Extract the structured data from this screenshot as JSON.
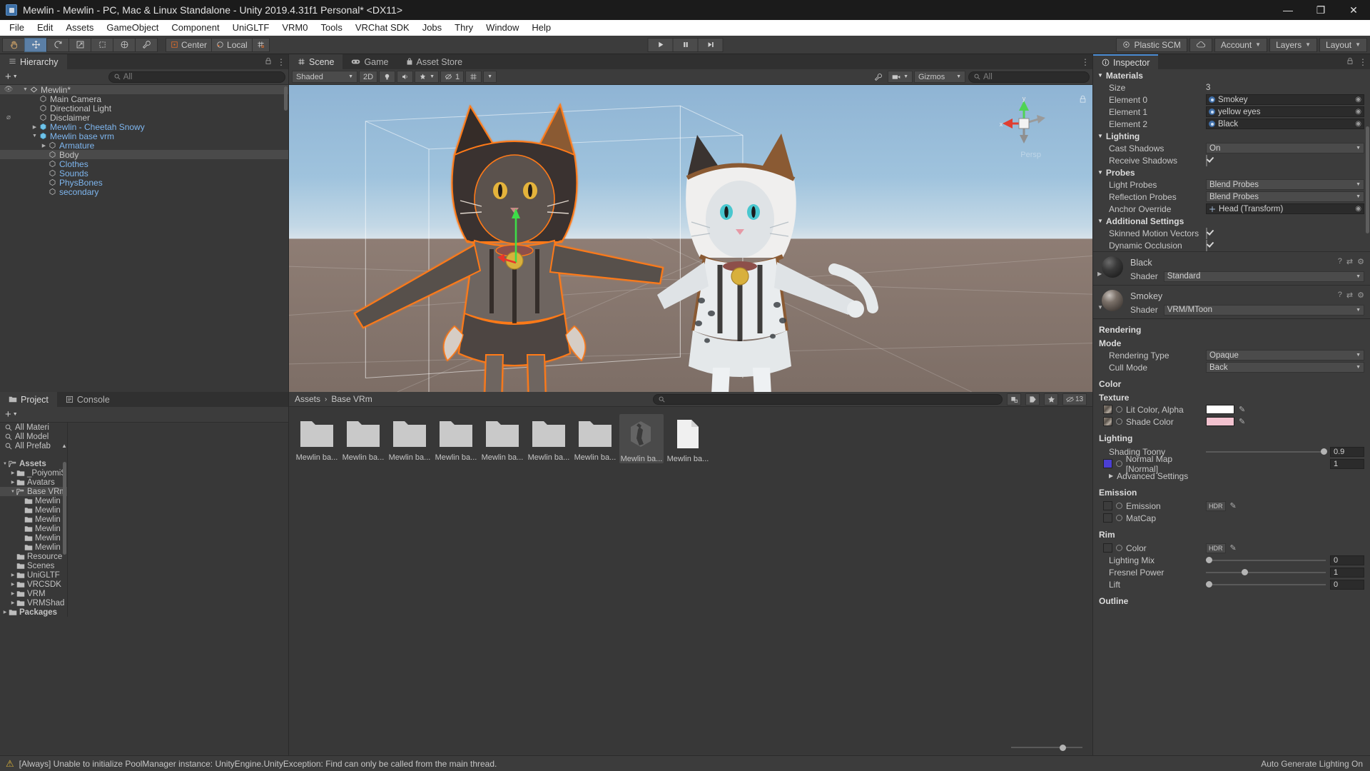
{
  "window": {
    "title": "Mewlin - Mewlin - PC, Mac & Linux Standalone - Unity 2019.4.31f1 Personal* <DX11>",
    "minimize": "—",
    "maximize": "❐",
    "close": "✕"
  },
  "menu": [
    "File",
    "Edit",
    "Assets",
    "GameObject",
    "Component",
    "UniGLTF",
    "VRM0",
    "Tools",
    "VRChat SDK",
    "Jobs",
    "Thry",
    "Window",
    "Help"
  ],
  "toolbar": {
    "pivot_mode": "Center",
    "pivot_rotation": "Local",
    "plastic_scm": "Plastic SCM",
    "account": "Account",
    "layers": "Layers",
    "layout": "Layout"
  },
  "hierarchy": {
    "tab": "Hierarchy",
    "search_placeholder": "All",
    "items": [
      {
        "label": "Mewlin*",
        "depth": 0,
        "icon": "scene-icon",
        "twisty": "down",
        "prefab": false,
        "selected": true,
        "eye": true
      },
      {
        "label": "Main Camera",
        "depth": 1,
        "icon": "gameobject-icon",
        "twisty": "",
        "prefab": false,
        "selected": false
      },
      {
        "label": "Directional Light",
        "depth": 1,
        "icon": "gameobject-icon",
        "twisty": "",
        "prefab": false,
        "selected": false
      },
      {
        "label": "Disclaimer",
        "depth": 1,
        "icon": "gameobject-icon",
        "twisty": "",
        "prefab": false,
        "selected": false,
        "hidden": true
      },
      {
        "label": "Mewlin - Cheetah Snowy",
        "depth": 1,
        "icon": "prefab-icon",
        "twisty": "right",
        "prefab": true,
        "selected": false
      },
      {
        "label": "Mewlin base vrm",
        "depth": 1,
        "icon": "prefab-icon",
        "twisty": "down",
        "prefab": true,
        "selected": false
      },
      {
        "label": "Armature",
        "depth": 2,
        "icon": "gameobject-icon",
        "twisty": "right",
        "prefab": true,
        "selected": false
      },
      {
        "label": "Body",
        "depth": 2,
        "icon": "gameobject-icon",
        "twisty": "",
        "prefab": false,
        "selected": true
      },
      {
        "label": "Clothes",
        "depth": 2,
        "icon": "gameobject-icon",
        "twisty": "",
        "prefab": true,
        "selected": false
      },
      {
        "label": "Sounds",
        "depth": 2,
        "icon": "gameobject-icon",
        "twisty": "",
        "prefab": true,
        "selected": false
      },
      {
        "label": "PhysBones",
        "depth": 2,
        "icon": "gameobject-icon",
        "twisty": "",
        "prefab": true,
        "selected": false
      },
      {
        "label": "secondary",
        "depth": 2,
        "icon": "gameobject-icon",
        "twisty": "",
        "prefab": true,
        "selected": false
      }
    ]
  },
  "scene": {
    "tabs": [
      {
        "label": "Scene",
        "icon": "grid-icon",
        "active": true
      },
      {
        "label": "Game",
        "icon": "gamepad-icon",
        "active": false
      },
      {
        "label": "Asset Store",
        "icon": "store-icon",
        "active": false
      }
    ],
    "draw_mode": "Shaded",
    "two_d": "2D",
    "gizmos": "Gizmos",
    "search_placeholder": "All",
    "audio_count": "1",
    "gizmo_axes": {
      "x": "x",
      "y": "y"
    },
    "perspective_label": "Persp"
  },
  "project": {
    "tabs": [
      {
        "label": "Project",
        "icon": "folder-icon",
        "active": true
      },
      {
        "label": "Console",
        "icon": "console-icon",
        "active": false
      }
    ],
    "breadcrumb": [
      "Assets",
      "Base VRm"
    ],
    "search_placeholder": "",
    "favorites": [
      "All Materi",
      "All Model",
      "All Prefab"
    ],
    "tree": [
      {
        "label": "Assets",
        "depth": 0,
        "twisty": "down",
        "open": true,
        "selected": false
      },
      {
        "label": "_PoiyomiS",
        "depth": 1,
        "twisty": "right",
        "open": false,
        "selected": false
      },
      {
        "label": "Avatars",
        "depth": 1,
        "twisty": "right",
        "open": false,
        "selected": false
      },
      {
        "label": "Base VRm",
        "depth": 1,
        "twisty": "down",
        "open": true,
        "selected": true
      },
      {
        "label": "Mewlin",
        "depth": 2,
        "twisty": "",
        "open": false,
        "selected": false
      },
      {
        "label": "Mewlin",
        "depth": 2,
        "twisty": "",
        "open": false,
        "selected": false
      },
      {
        "label": "Mewlin",
        "depth": 2,
        "twisty": "",
        "open": false,
        "selected": false
      },
      {
        "label": "Mewlin",
        "depth": 2,
        "twisty": "",
        "open": false,
        "selected": false
      },
      {
        "label": "Mewlin",
        "depth": 2,
        "twisty": "",
        "open": false,
        "selected": false
      },
      {
        "label": "Mewlin",
        "depth": 2,
        "twisty": "",
        "open": false,
        "selected": false
      },
      {
        "label": "Resource",
        "depth": 1,
        "twisty": "",
        "open": false,
        "selected": false
      },
      {
        "label": "Scenes",
        "depth": 1,
        "twisty": "",
        "open": false,
        "selected": false
      },
      {
        "label": "UniGLTF",
        "depth": 1,
        "twisty": "right",
        "open": false,
        "selected": false
      },
      {
        "label": "VRCSDK",
        "depth": 1,
        "twisty": "right",
        "open": false,
        "selected": false
      },
      {
        "label": "VRM",
        "depth": 1,
        "twisty": "right",
        "open": false,
        "selected": false
      },
      {
        "label": "VRMShad",
        "depth": 1,
        "twisty": "right",
        "open": false,
        "selected": false
      },
      {
        "label": "Packages",
        "depth": 0,
        "twisty": "right",
        "open": false,
        "selected": false
      }
    ],
    "assets": [
      {
        "label": "Mewlin ba...",
        "type": "folder",
        "selected": false
      },
      {
        "label": "Mewlin ba...",
        "type": "folder",
        "selected": false
      },
      {
        "label": "Mewlin ba...",
        "type": "folder",
        "selected": false
      },
      {
        "label": "Mewlin ba...",
        "type": "folder",
        "selected": false
      },
      {
        "label": "Mewlin ba...",
        "type": "folder",
        "selected": false
      },
      {
        "label": "Mewlin ba...",
        "type": "folder",
        "selected": false
      },
      {
        "label": "Mewlin ba...",
        "type": "folder",
        "selected": false
      },
      {
        "label": "Mewlin ba...",
        "type": "model",
        "selected": true
      },
      {
        "label": "Mewlin ba...",
        "type": "file",
        "selected": false
      }
    ],
    "badge_count": "13"
  },
  "inspector": {
    "tab": "Inspector",
    "sections": {
      "materials": {
        "header": "Materials",
        "size_label": "Size",
        "size_value": "3",
        "elements": [
          {
            "label": "Element 0",
            "value": "Smokey"
          },
          {
            "label": "Element 1",
            "value": "yellow eyes"
          },
          {
            "label": "Element 2",
            "value": "Black"
          }
        ]
      },
      "lighting": {
        "header": "Lighting",
        "cast_shadows_label": "Cast Shadows",
        "cast_shadows_value": "On",
        "receive_shadows_label": "Receive Shadows",
        "receive_shadows_checked": true
      },
      "probes": {
        "header": "Probes",
        "light_probes_label": "Light Probes",
        "light_probes_value": "Blend Probes",
        "reflection_probes_label": "Reflection Probes",
        "reflection_probes_value": "Blend Probes",
        "anchor_override_label": "Anchor Override",
        "anchor_override_value": "Head (Transform)"
      },
      "additional": {
        "header": "Additional Settings",
        "skinned_motion_label": "Skinned Motion Vectors",
        "skinned_motion_checked": true,
        "dynamic_occlusion_label": "Dynamic Occlusion",
        "dynamic_occlusion_checked": true
      }
    },
    "material_black": {
      "name": "Black",
      "shader_label": "Shader",
      "shader_value": "Standard"
    },
    "material_smokey": {
      "name": "Smokey",
      "shader_label": "Shader",
      "shader_value": "VRM/MToon",
      "rendering_header": "Rendering",
      "mode_label": "Mode",
      "rendering_type_label": "Rendering Type",
      "rendering_type_value": "Opaque",
      "cull_mode_label": "Cull Mode",
      "cull_mode_value": "Back",
      "color_header": "Color",
      "texture_header": "Texture",
      "lit_color_label": "Lit Color, Alpha",
      "lit_color_hex": "#ffffff",
      "shade_color_label": "Shade Color",
      "shade_color_hex": "#f2c2cf",
      "lighting_header": "Lighting",
      "shading_toony_label": "Shading Toony",
      "shading_toony_value": "0.9",
      "normal_map_label": "Normal Map [Normal]",
      "normal_map_value": "1",
      "normal_map_swatch": "#4b3fd4",
      "advanced_settings_label": "Advanced Settings",
      "emission_header": "Emission",
      "emission_label": "Emission",
      "matcap_label": "MatCap",
      "hdr_badge": "HDR",
      "rim_header": "Rim",
      "rim_color_label": "Color",
      "lighting_mix_label": "Lighting Mix",
      "lighting_mix_value": "0",
      "fresnel_power_label": "Fresnel Power",
      "fresnel_power_value": "1",
      "lift_label": "Lift",
      "lift_value": "0",
      "outline_header": "Outline"
    }
  },
  "statusbar": {
    "message": "[Always] Unable to initialize PoolManager instance: UnityEngine.UnityException: Find can only be called from the main thread.",
    "right": "Auto Generate Lighting On"
  },
  "colors": {
    "accent_blue": "#4b8dd4",
    "prefab_blue": "#7eb6ef",
    "warn_yellow": "#d8b13a",
    "selection_orange": "#ff7a18",
    "panel_bg": "#383838",
    "panel_header": "#3c3c3c"
  }
}
